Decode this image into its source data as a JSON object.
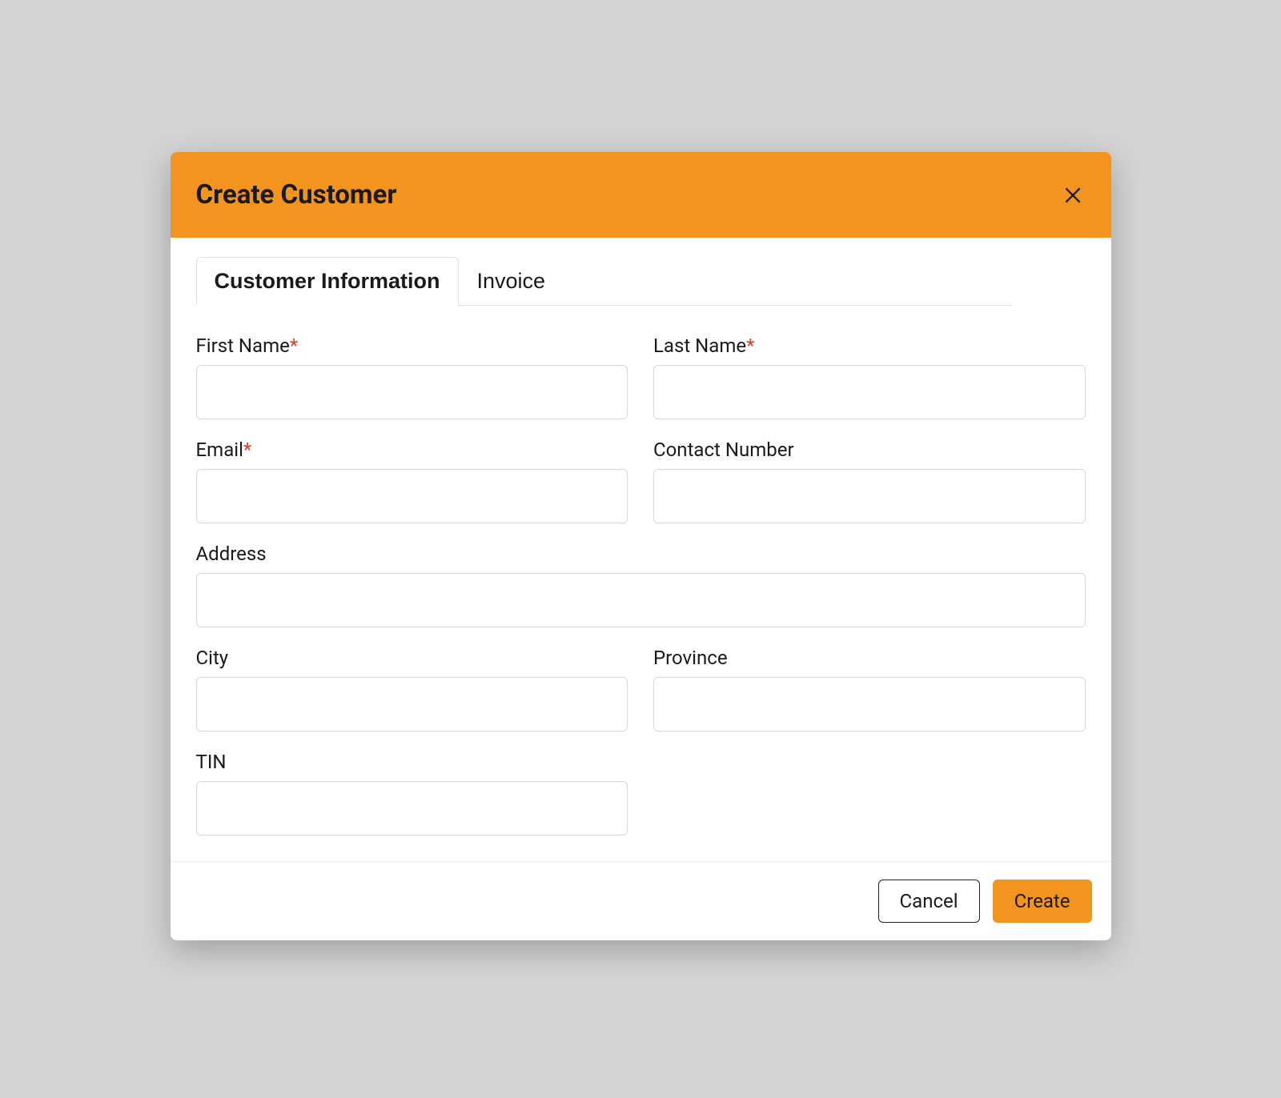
{
  "modal": {
    "title": "Create Customer"
  },
  "tabs": {
    "customer_info": "Customer Information",
    "invoice": "Invoice"
  },
  "fields": {
    "first_name": {
      "label": "First Name",
      "required": "*",
      "value": ""
    },
    "last_name": {
      "label": "Last Name",
      "required": "*",
      "value": ""
    },
    "email": {
      "label": "Email",
      "required": "*",
      "value": ""
    },
    "contact_number": {
      "label": "Contact Number",
      "value": ""
    },
    "address": {
      "label": "Address",
      "value": ""
    },
    "city": {
      "label": "City",
      "value": ""
    },
    "province": {
      "label": "Province",
      "value": ""
    },
    "tin": {
      "label": "TIN",
      "value": ""
    }
  },
  "buttons": {
    "cancel": "Cancel",
    "create": "Create"
  }
}
